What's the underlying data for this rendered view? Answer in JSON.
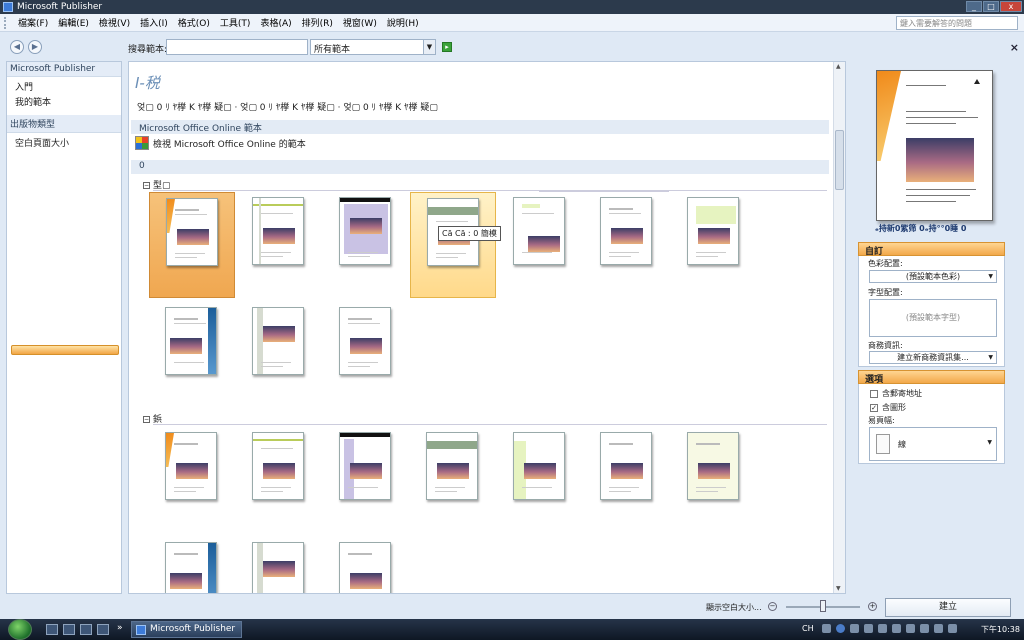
{
  "window": {
    "title": "Microsoft Publisher",
    "min": "_",
    "max": "□",
    "close": "x"
  },
  "menubar": {
    "items": [
      "檔案(F)",
      "編輯(E)",
      "檢視(V)",
      "插入(I)",
      "格式(O)",
      "工具(T)",
      "表格(A)",
      "排列(R)",
      "視窗(W)",
      "說明(H)"
    ],
    "help_placeholder": "鍵入需要解答的問題"
  },
  "toolbar": {
    "back": "◀",
    "forward": "▶",
    "search_label": "搜尋範本:",
    "scope_value": "所有範本",
    "dropdown": "▼",
    "go": "▸",
    "close": "×"
  },
  "left_pane": {
    "section1_title": "Microsoft Publisher",
    "section1_items": [
      "入門",
      "我的範本"
    ],
    "section2_title": "出版物類型",
    "section2_items": [
      "空白頁面大小"
    ]
  },
  "main": {
    "title": "I-税",
    "row": "엊▢ 0 ﾘ ﾔ﨔 K ﾔ﨔 疑▢ · 엊▢ 0 ﾘ ﾔ﨔 K ﾔ﨔 疑▢ · 엊▢ 0 ﾘ ﾔ﨔 K ﾔ﨔 疑▢",
    "online_title": "Microsoft Office Online 範本",
    "online_link": "檢視 Microsoft Office Online 的範本",
    "section_zero": "0",
    "group1": "型▢",
    "group2": "鋲",
    "expand_glyph": "−",
    "tooltip": "Cā Cā ː 0 簡模"
  },
  "right_pane": {
    "preview_caption": "ₑ持新0紫筛    0ₑ持°°0睡  0",
    "customize_title": "自訂",
    "color_label": "色彩配置:",
    "color_value": "(預設範本色彩)",
    "font_label": "字型配置:",
    "font_value": "(預設範本字型)",
    "business_label": "商務資訊:",
    "business_value": "建立新商務資訊集...",
    "options_title": "選項",
    "opt_mail": "含郵寄地址",
    "opt_graphic": "含圖形",
    "opt_graphic_checked": "✓",
    "page_size_label": "易頁幅:",
    "page_size_value": "線",
    "arrow": "▼"
  },
  "statusbar": {
    "zoom_label": "顯示空白大小...",
    "zoom_out": "−",
    "zoom_in": "+",
    "create": "建立"
  },
  "taskbar": {
    "app": "Microsoft Publisher",
    "more": "»",
    "lang": "CH",
    "clock": "下午10:38"
  }
}
